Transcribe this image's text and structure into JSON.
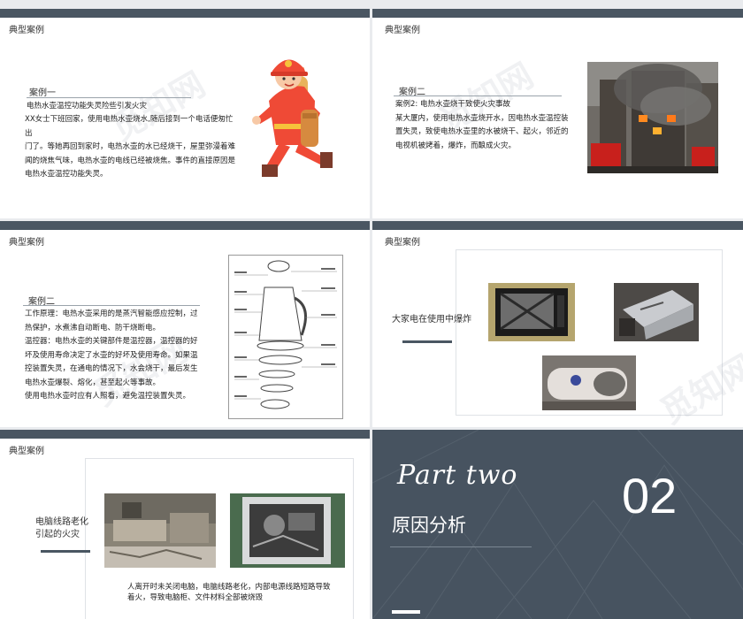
{
  "common": {
    "section_tag": "典型案例",
    "watermark": "觅知网"
  },
  "slide1": {
    "case_label": "案例一",
    "case_title": "电热水壶温控功能失灵险些引发火灾",
    "body_lines": [
      "XX女士下班回家，使用电热水壶烧水,随后接到一个电话便匆忙出",
      "门了。等她再回到家时，电热水壶的水已经烧干，屋里弥漫着难",
      "闻的烧焦气味，电热水壶的电线已经被烧焦。事件的直接原因是",
      "电热水壶温控功能失灵。"
    ]
  },
  "slide2": {
    "case_label": "案例二",
    "body_lines": [
      "案例2: 电热水壶烧干致使火灾事故",
      "某大厦内，使用电热水壶烧开水，因电热水壶温控装",
      "置失灵，致使电热水壶里的水被烧干、起火，邻近的",
      "电视机被烤着，爆炸，而酿成火灾。"
    ]
  },
  "slide3": {
    "case_label": "案例二",
    "body_lines": [
      "工作原理：电热水壶采用的是蒸汽智能感应控制，过",
      "热保护，水煮沸自动断电、防干烧断电。",
      "温控器：电热水壶的关键部件是温控器，温控器的好",
      "坏及使用寿命决定了水壶的好坏及使用寿命。如果温",
      "控装置失灵，在通电的情况下，水会烧干，最后发生",
      "电热水壶爆裂、熔化，甚至起火等事故。",
      "使用电热水壶时应有人照看，避免温控装置失灵。"
    ]
  },
  "slide4": {
    "caption": "大家电在使用中爆炸"
  },
  "slide5": {
    "side_lines": [
      "电脑线路老化",
      "引起的火灾"
    ],
    "body_lines": [
      "人离开时未关闭电脑，电脑线路老化，内部电源线路短路导致",
      "着火，导致电脑柜、文件材料全部被烧毁"
    ]
  },
  "slide6": {
    "title_en": "Part  two",
    "number": "02",
    "title_cn": "原因分析"
  }
}
